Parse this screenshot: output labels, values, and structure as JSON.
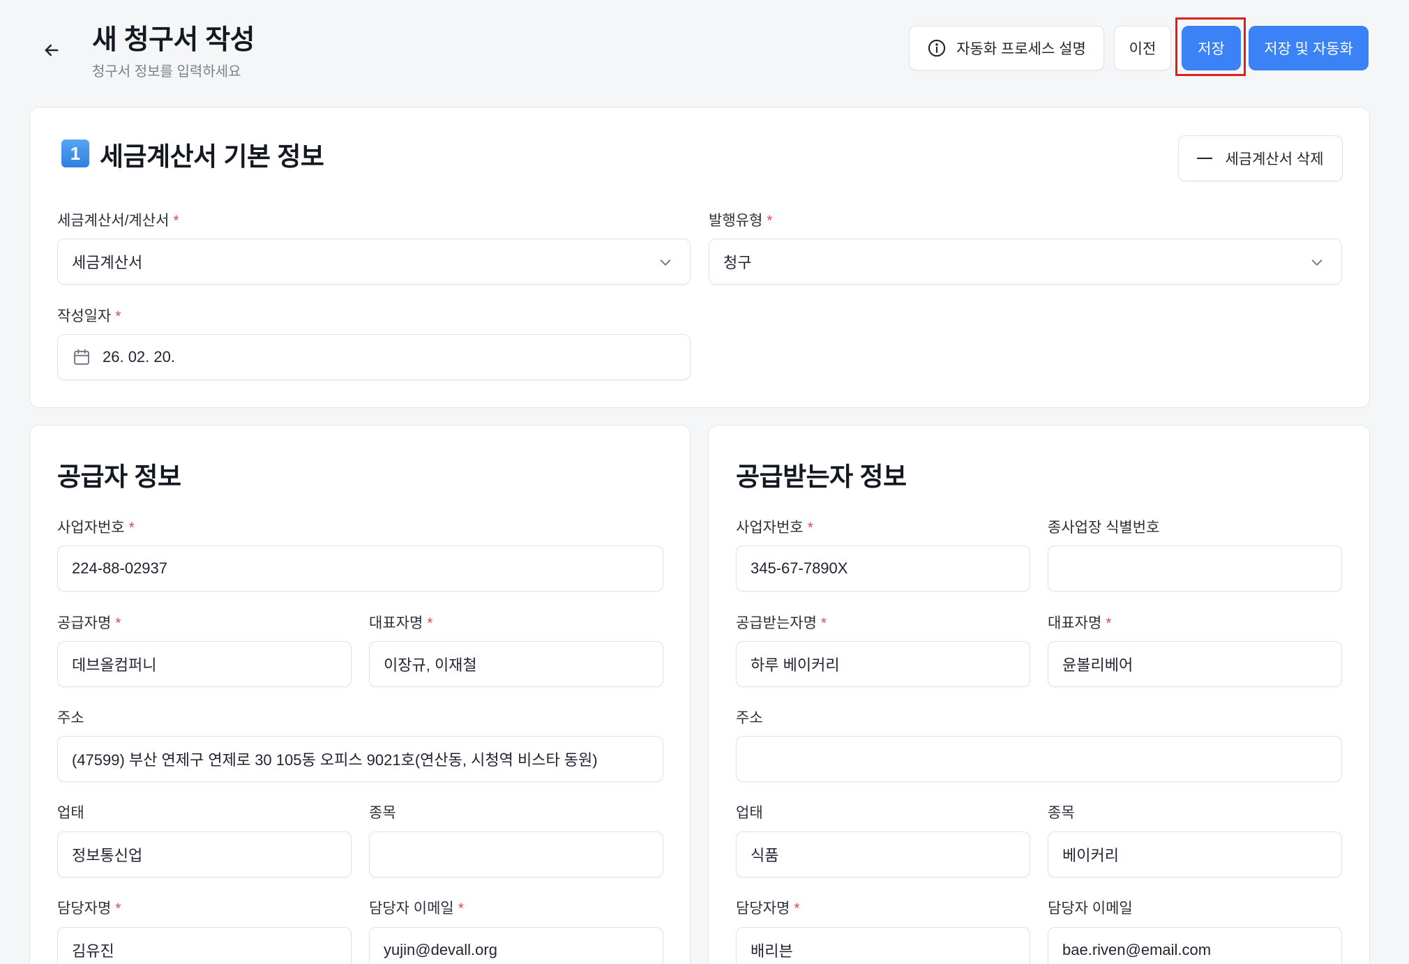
{
  "header": {
    "title": "새 청구서 작성",
    "subtitle": "청구서 정보를 입력하세요",
    "buttons": {
      "help": "자동화 프로세스 설명",
      "prev": "이전",
      "save": "저장",
      "save_auto": "저장 및 자동화"
    }
  },
  "basic": {
    "badge": "1",
    "title": "세금계산서 기본 정보",
    "delete_label": "세금계산서 삭제",
    "type_label": "세금계산서/계산서",
    "type_value": "세금계산서",
    "issue_label": "발행유형",
    "issue_value": "청구",
    "date_label": "작성일자",
    "date_value": "26. 02. 20."
  },
  "supplier": {
    "title": "공급자 정보",
    "bizno_label": "사업자번호",
    "bizno_value": "224-88-02937",
    "name_label": "공급자명",
    "name_value": "데브올컴퍼니",
    "ceo_label": "대표자명",
    "ceo_value": "이장규, 이재철",
    "addr_label": "주소",
    "addr_value": "(47599) 부산 연제구 연제로 30 105동 오피스 9021호(연산동, 시청역 비스타 동원)",
    "biztype_label": "업태",
    "biztype_value": "정보통신업",
    "item_label": "종목",
    "item_value": "",
    "manager_label": "담당자명",
    "manager_value": "김유진",
    "email_label": "담당자 이메일",
    "email_value": "yujin@devall.org"
  },
  "buyer": {
    "title": "공급받는자 정보",
    "bizno_label": "사업자번호",
    "bizno_value": "345-67-7890X",
    "branch_label": "종사업장 식별번호",
    "branch_value": "",
    "name_label": "공급받는자명",
    "name_value": "하루 베이커리",
    "ceo_label": "대표자명",
    "ceo_value": "윤볼리베어",
    "addr_label": "주소",
    "addr_value": "",
    "biztype_label": "업태",
    "biztype_value": "식품",
    "item_label": "종목",
    "item_value": "베이커리",
    "manager_label": "담당자명",
    "manager_value": "배리븐",
    "email_label": "담당자 이메일",
    "email_value": "bae.riven@email.com"
  },
  "colors": {
    "primary": "#3b82f6",
    "required": "#e5484d",
    "highlight": "#e11d1d"
  },
  "icons": {
    "back": "arrow-left-icon",
    "help": "info-circle-icon",
    "delete": "minus-icon",
    "select": "chevron-down-icon",
    "date": "calendar-icon"
  }
}
